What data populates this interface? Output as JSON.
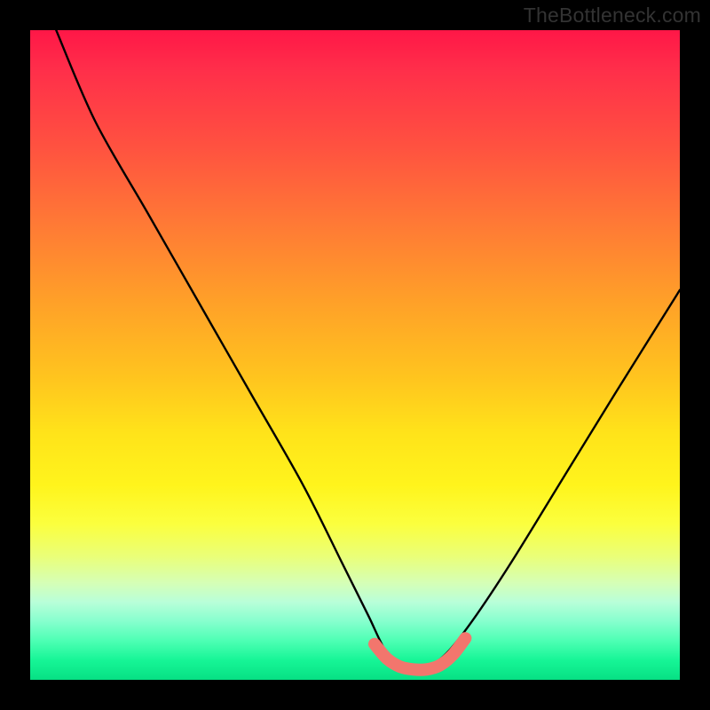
{
  "watermark": "TheBottleneck.com",
  "chart_data": {
    "type": "line",
    "title": "",
    "xlabel": "",
    "ylabel": "",
    "xlim": [
      0,
      100
    ],
    "ylim": [
      0,
      100
    ],
    "grid": false,
    "legend": false,
    "annotations": [],
    "series": [
      {
        "name": "bottleneck-curve",
        "color": "#000000",
        "x": [
          4,
          10,
          18,
          26,
          34,
          42,
          48,
          52,
          55,
          58,
          61,
          64,
          68,
          74,
          82,
          90,
          100
        ],
        "values": [
          100,
          86,
          72,
          58,
          44,
          30,
          18,
          10,
          4,
          2,
          2,
          4,
          9,
          18,
          31,
          44,
          60
        ]
      },
      {
        "name": "sweet-spot-band",
        "color": "#f2766d",
        "x": [
          53,
          55,
          57,
          59,
          61,
          63,
          65,
          67
        ],
        "values": [
          5.5,
          3.2,
          2.0,
          1.6,
          1.6,
          2.2,
          3.8,
          6.4
        ]
      }
    ]
  }
}
